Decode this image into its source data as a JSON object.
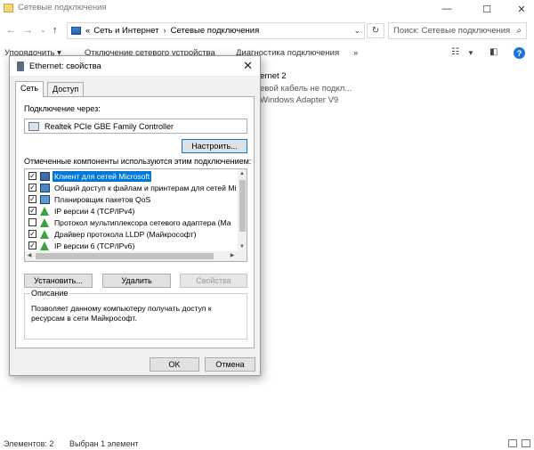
{
  "explorer": {
    "title": "Сетевые подключения",
    "breadcrumb_prefix": "«",
    "breadcrumb": [
      "Сеть и Интернет",
      "Сетевые подключения"
    ],
    "search_placeholder": "Поиск: Сетевые подключения",
    "toolbar": [
      "Упорядочить ▾",
      "Отключение сетевого устройства",
      "Диагностика подключения",
      "»"
    ],
    "background_items": [
      "ernet 2",
      "евой кабель не подкл...",
      "Windows Adapter V9"
    ],
    "status": {
      "items": "Элементов: 2",
      "selected": "Выбран 1 элемент"
    }
  },
  "dialog": {
    "title": "Ethernet: свойства",
    "tabs": [
      "Сеть",
      "Доступ"
    ],
    "connect_label": "Подключение через:",
    "adapter": "Realtek PCIe GBE Family Controller",
    "configure": "Настроить...",
    "components_label": "Отмеченные компоненты используются этим подключением:",
    "components": [
      {
        "label": "Клиент для сетей Microsoft",
        "checked": true,
        "icon": "client",
        "selected": true
      },
      {
        "label": "Общий доступ к файлам и принтерам для сетей Mi",
        "checked": true,
        "icon": "share",
        "selected": false
      },
      {
        "label": "Планировщик пакетов QoS",
        "checked": true,
        "icon": "qos",
        "selected": false
      },
      {
        "label": "IP версии 4 (TCP/IPv4)",
        "checked": true,
        "icon": "proto",
        "selected": false
      },
      {
        "label": "Протокол мультиплексора сетевого адаптера (Ма",
        "checked": false,
        "icon": "proto",
        "selected": false
      },
      {
        "label": "Драйвер протокола LLDP (Майкрософт)",
        "checked": true,
        "icon": "proto",
        "selected": false
      },
      {
        "label": "IP версии 6 (TCP/IPv6)",
        "checked": true,
        "icon": "proto",
        "selected": false
      }
    ],
    "buttons": {
      "install": "Установить...",
      "remove": "Удалить",
      "properties": "Свойства"
    },
    "description_title": "Описание",
    "description": "Позволяет данному компьютеру получать доступ к ресурсам в сети Майкрософт.",
    "ok": "OK",
    "cancel": "Отмена"
  }
}
